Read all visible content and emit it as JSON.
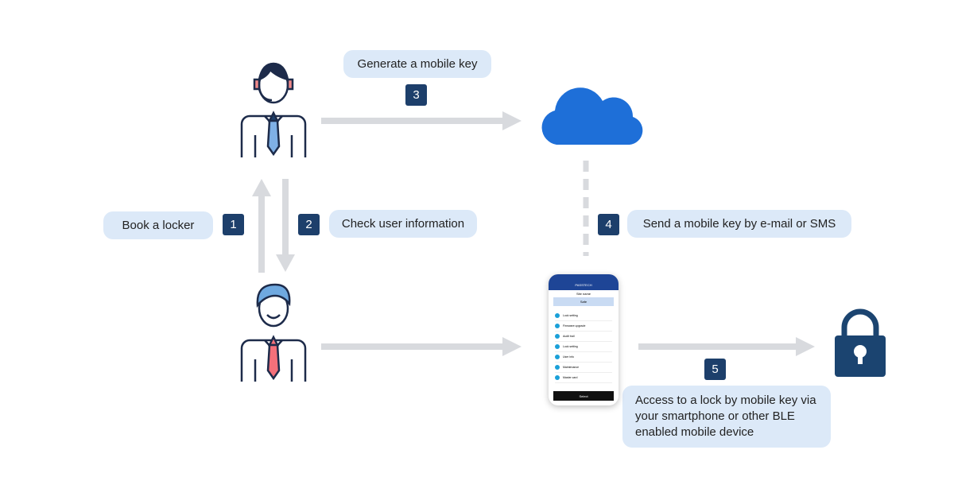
{
  "steps": [
    {
      "number": "1",
      "label": "Book a locker"
    },
    {
      "number": "2",
      "label": "Check user information"
    },
    {
      "number": "3",
      "label": "Generate a mobile key"
    },
    {
      "number": "4",
      "label": "Send a mobile key by e-mail or SMS"
    },
    {
      "number": "5",
      "label": "Access to a lock by mobile key via your smartphone or other BLE enabled mobile device"
    }
  ],
  "phone": {
    "brand": "PASSTECH",
    "site": "Site name",
    "section": "Safe",
    "items": [
      "Lock setting",
      "Firmware upgrade",
      "Audit trail",
      "Lock setting",
      "User info",
      "Maintenance",
      "Master card"
    ],
    "button": "Select"
  },
  "colors": {
    "badge": "#1d3f6b",
    "bubble": "#dce9f8",
    "arrow": "#d8dade",
    "cloud": "#1e6fd8",
    "lock": "#1b4470"
  }
}
